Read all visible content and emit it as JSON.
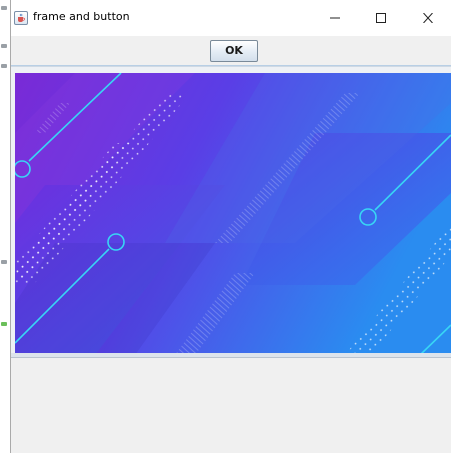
{
  "window": {
    "title": "frame and button"
  },
  "toolbar": {
    "ok_label": "OK"
  },
  "colors": {
    "banner_gradient_start": "#7a2ad6",
    "banner_gradient_end": "#2a8cf0",
    "accent_line": "#38d6f5",
    "titlebar_bg": "#ffffff",
    "window_bg": "#f0f0f0"
  },
  "icons": {
    "app": "java-cup-icon",
    "minimize": "minimize-icon",
    "maximize": "maximize-icon",
    "close": "close-icon"
  }
}
